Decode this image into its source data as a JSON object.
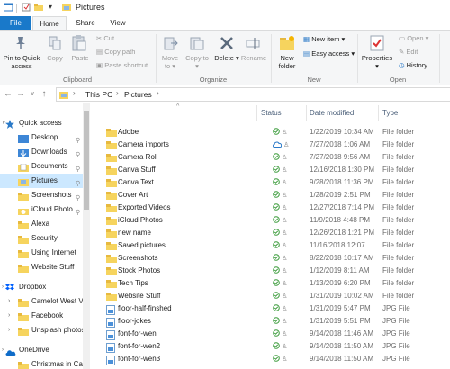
{
  "window": {
    "title": "Pictures"
  },
  "ribbon_tabs": [
    "File",
    "Home",
    "Share",
    "View"
  ],
  "ribbon": {
    "pin_quick_access": "Pin to Quick access",
    "copy": "Copy",
    "paste": "Paste",
    "cut": "Cut",
    "copy_path": "Copy path",
    "paste_shortcut": "Paste shortcut",
    "move_to": "Move to",
    "copy_to": "Copy to",
    "delete": "Delete",
    "rename": "Rename",
    "new_folder": "New folder",
    "new_item": "New item",
    "easy_access": "Easy access",
    "properties": "Properties",
    "open": "Open",
    "edit": "Edit",
    "history": "History",
    "groups": {
      "clipboard": "Clipboard",
      "organize": "Organize",
      "new": "New",
      "open": "Open"
    }
  },
  "address": {
    "crumbs": [
      "This PC",
      "Pictures"
    ]
  },
  "columns": {
    "name_sort_indicator": "^",
    "status": "Status",
    "date": "Date modified",
    "type": "Type"
  },
  "nav_pane": [
    {
      "label": "Quick access",
      "icon": "star-icon",
      "pinned": false
    },
    {
      "label": "Desktop",
      "icon": "desktop-icon",
      "pinned": true
    },
    {
      "label": "Downloads",
      "icon": "download-icon",
      "pinned": true
    },
    {
      "label": "Documents",
      "icon": "documents-icon",
      "pinned": true
    },
    {
      "label": "Pictures",
      "icon": "pictures-icon",
      "pinned": true,
      "selected": true
    },
    {
      "label": "Screenshots",
      "icon": "folder-icon",
      "pinned": true
    },
    {
      "label": "iCloud Photo",
      "icon": "icloud-icon",
      "pinned": true
    },
    {
      "label": "Alexa",
      "icon": "folder-icon",
      "pinned": false
    },
    {
      "label": "Security",
      "icon": "folder-icon",
      "pinned": false
    },
    {
      "label": "Using Internet",
      "icon": "folder-icon",
      "pinned": false
    },
    {
      "label": "Website Stuff",
      "icon": "folder-icon",
      "pinned": false
    },
    {
      "label": "Dropbox",
      "icon": "dropbox-icon",
      "pinned": false
    },
    {
      "label": "Camelot West Vi",
      "icon": "folder-icon",
      "pinned": false
    },
    {
      "label": "Facebook",
      "icon": "folder-icon",
      "pinned": false
    },
    {
      "label": "Unsplash photos",
      "icon": "folder-icon",
      "pinned": false
    },
    {
      "label": "OneDrive",
      "icon": "onedrive-icon",
      "pinned": false
    },
    {
      "label": "Christmas in Ca",
      "icon": "folder-icon",
      "pinned": false
    }
  ],
  "files": [
    {
      "name": "Adobe",
      "status": "ok",
      "date": "1/22/2019 10:34 AM",
      "type": "File folder",
      "kind": "folder"
    },
    {
      "name": "Camera imports",
      "status": "cloud",
      "date": "7/27/2018 1:06 AM",
      "type": "File folder",
      "kind": "folder"
    },
    {
      "name": "Camera Roll",
      "status": "ok",
      "date": "7/27/2018 9:56 AM",
      "type": "File folder",
      "kind": "folder"
    },
    {
      "name": "Canva Stuff",
      "status": "ok",
      "date": "12/16/2018 1:30 PM",
      "type": "File folder",
      "kind": "folder"
    },
    {
      "name": "Canva Text",
      "status": "ok",
      "date": "9/28/2018 11:36 PM",
      "type": "File folder",
      "kind": "folder"
    },
    {
      "name": "Cover Art",
      "status": "ok",
      "date": "1/28/2019 2:51 PM",
      "type": "File folder",
      "kind": "folder"
    },
    {
      "name": "Exported Videos",
      "status": "ok",
      "date": "12/27/2018 7:14 PM",
      "type": "File folder",
      "kind": "folder"
    },
    {
      "name": "iCloud Photos",
      "status": "ok",
      "date": "11/9/2018 4:48 PM",
      "type": "File folder",
      "kind": "folder"
    },
    {
      "name": "new name",
      "status": "ok",
      "date": "12/26/2018 1:21 PM",
      "type": "File folder",
      "kind": "folder"
    },
    {
      "name": "Saved pictures",
      "status": "ok",
      "date": "11/16/2018 12:07 ...",
      "type": "File folder",
      "kind": "folder"
    },
    {
      "name": "Screenshots",
      "status": "ok",
      "date": "8/22/2018 10:17 AM",
      "type": "File folder",
      "kind": "folder"
    },
    {
      "name": "Stock Photos",
      "status": "ok",
      "date": "1/12/2019 8:11 AM",
      "type": "File folder",
      "kind": "folder"
    },
    {
      "name": "Tech Tips",
      "status": "ok",
      "date": "1/13/2019 6:20 PM",
      "type": "File folder",
      "kind": "folder"
    },
    {
      "name": "Website Stuff",
      "status": "ok",
      "date": "1/31/2019 10:02 AM",
      "type": "File folder",
      "kind": "folder"
    },
    {
      "name": "floor-half-finshed",
      "status": "ok",
      "date": "1/31/2019 5:47 PM",
      "type": "JPG File",
      "kind": "jpg"
    },
    {
      "name": "floor-jokes",
      "status": "ok",
      "date": "1/31/2019 5:51 PM",
      "type": "JPG File",
      "kind": "jpg"
    },
    {
      "name": "font-for-wen",
      "status": "ok",
      "date": "9/14/2018 11:46 AM",
      "type": "JPG File",
      "kind": "jpg"
    },
    {
      "name": "font-for-wen2",
      "status": "ok",
      "date": "9/14/2018 11:50 AM",
      "type": "JPG File",
      "kind": "jpg"
    },
    {
      "name": "font-for-wen3",
      "status": "ok",
      "date": "9/14/2018 11:50 AM",
      "type": "JPG File",
      "kind": "jpg"
    }
  ],
  "colors": {
    "accent": "#1979ca",
    "selection": "#cce8ff",
    "folder": "#f6d45e",
    "sync_ok": "#3a9b3a",
    "sync_cloud": "#2b7ac8"
  }
}
